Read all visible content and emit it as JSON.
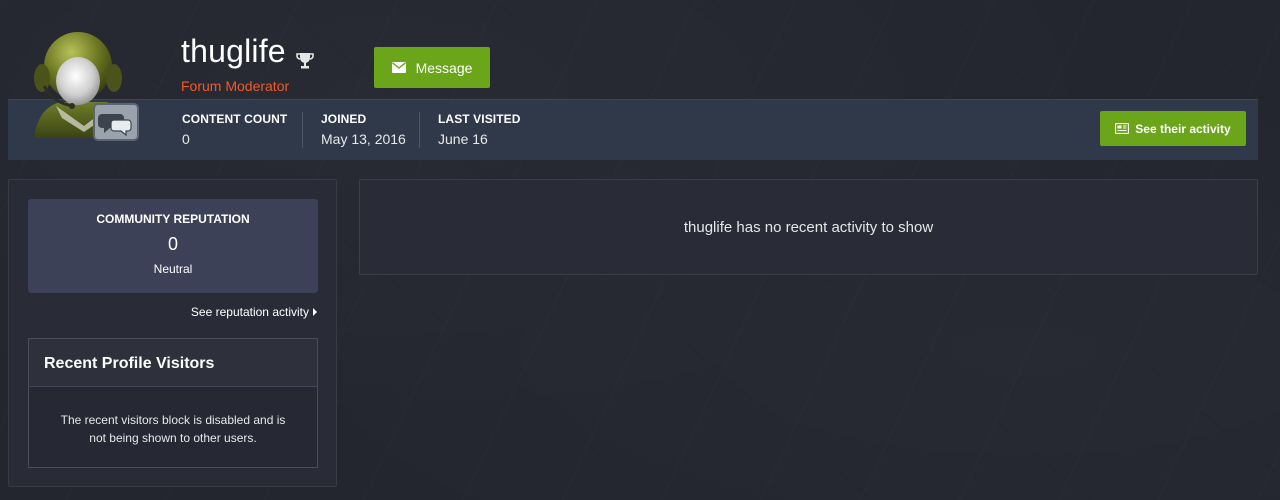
{
  "profile": {
    "username": "thuglife",
    "role": "Forum Moderator",
    "role_color": "#f05a28",
    "avatar_icon": "soldier-avatar-icon",
    "badge_icon": "trophy-icon"
  },
  "header": {
    "message_label": "Message",
    "message_icon": "envelope-icon",
    "activity_label": "See their activity",
    "activity_icon": "newspaper-icon",
    "accent_color": "#6aa51a"
  },
  "stats": [
    {
      "label": "CONTENT COUNT",
      "value": "0"
    },
    {
      "label": "JOINED",
      "value": "May 13, 2016"
    },
    {
      "label": "LAST VISITED",
      "value": "June 16"
    }
  ],
  "reputation": {
    "title": "COMMUNITY REPUTATION",
    "value": "0",
    "label": "Neutral",
    "link": "See reputation activity"
  },
  "visitors": {
    "title": "Recent Profile Visitors",
    "message": "The recent visitors block is disabled and is not being shown to other users."
  },
  "main": {
    "empty_message": "thuglife has no recent activity to show"
  }
}
